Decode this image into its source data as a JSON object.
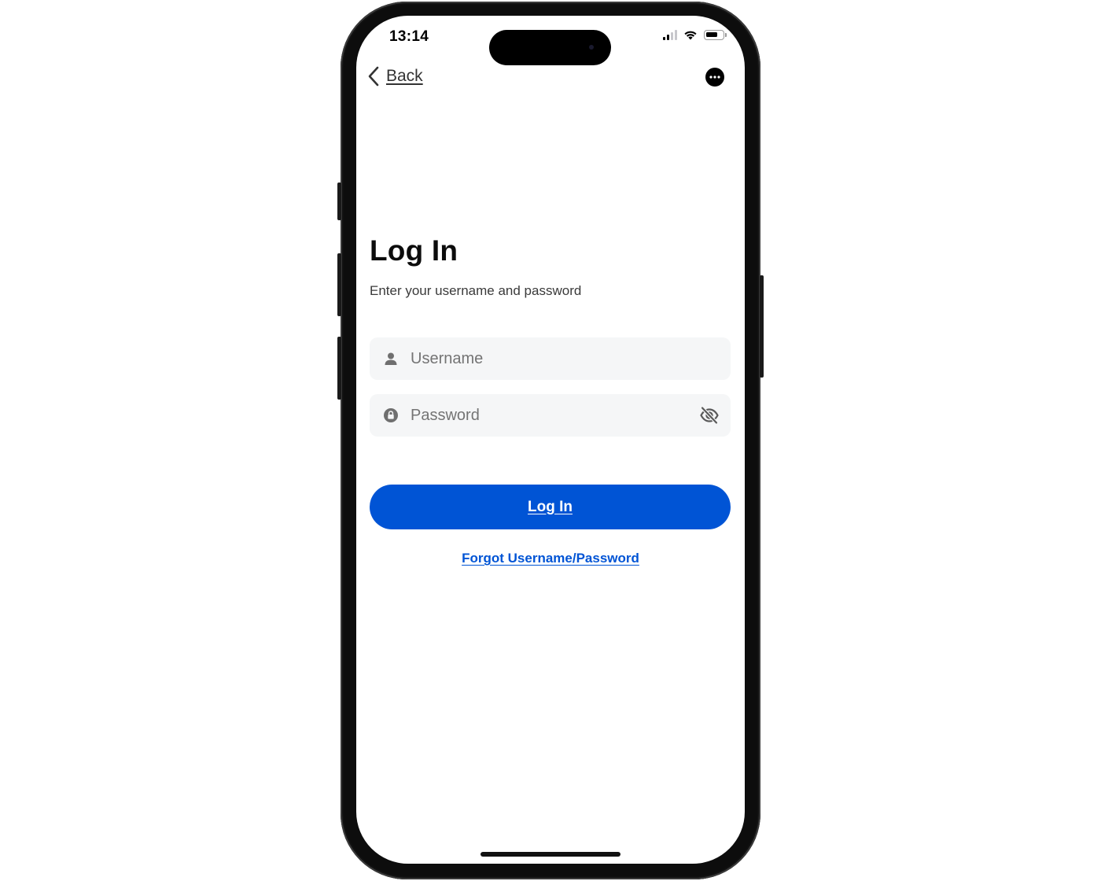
{
  "status_bar": {
    "time": "13:14",
    "signal_bars_filled": 2,
    "signal_bars_total": 4,
    "battery_level": 0.75
  },
  "nav": {
    "back_label": "Back",
    "back_icon": "chevron-left-icon",
    "more_icon": "more-horizontal-icon"
  },
  "login": {
    "title": "Log In",
    "subtitle": "Enter your username and password",
    "username": {
      "placeholder": "Username",
      "value": "",
      "icon": "user-icon"
    },
    "password": {
      "placeholder": "Password",
      "value": "",
      "icon": "lock-icon",
      "toggle_icon": "eye-off-icon"
    },
    "submit_label": "Log In",
    "forgot_label": "Forgot Username/Password"
  },
  "colors": {
    "primary": "#0054d5",
    "field_background": "#f5f6f7",
    "text": "#0c0c0c"
  }
}
